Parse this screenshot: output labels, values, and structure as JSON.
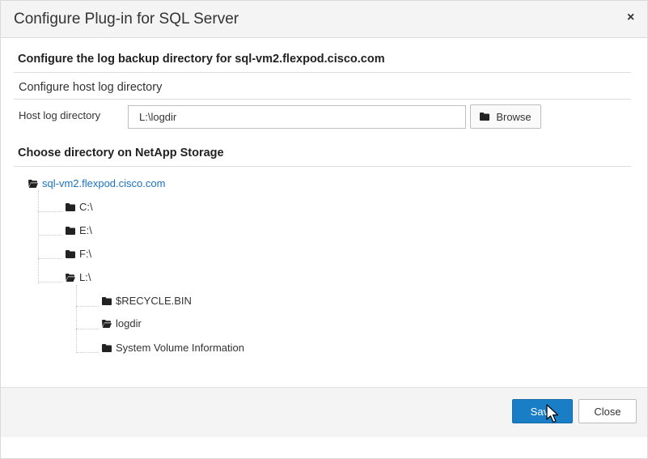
{
  "dialog": {
    "title": "Configure Plug-in for SQL Server",
    "close_glyph": "×"
  },
  "section1": {
    "title": "Configure the log backup directory for sql-vm2.flexpod.cisco.com",
    "subtitle": "Configure host log directory",
    "field_label": "Host log directory",
    "field_value": "L:\\logdir",
    "browse_label": "Browse"
  },
  "section2": {
    "title": "Choose directory on NetApp Storage"
  },
  "tree": {
    "root": "sql-vm2.flexpod.cisco.com",
    "drives": [
      "C:\\",
      "E:\\",
      "F:\\",
      "L:\\"
    ],
    "l_children": [
      "$RECYCLE.BIN",
      "logdir",
      "System Volume Information"
    ]
  },
  "footer": {
    "save_label": "Save",
    "close_label": "Close"
  },
  "colors": {
    "accent": "#1a7ec7",
    "link": "#1a73c0",
    "header_bg": "#f4f4f4"
  },
  "icons": {
    "folder_closed": "folder-icon",
    "folder_open": "folder-open-icon",
    "close": "close-icon",
    "cursor": "mouse-pointer-icon"
  }
}
